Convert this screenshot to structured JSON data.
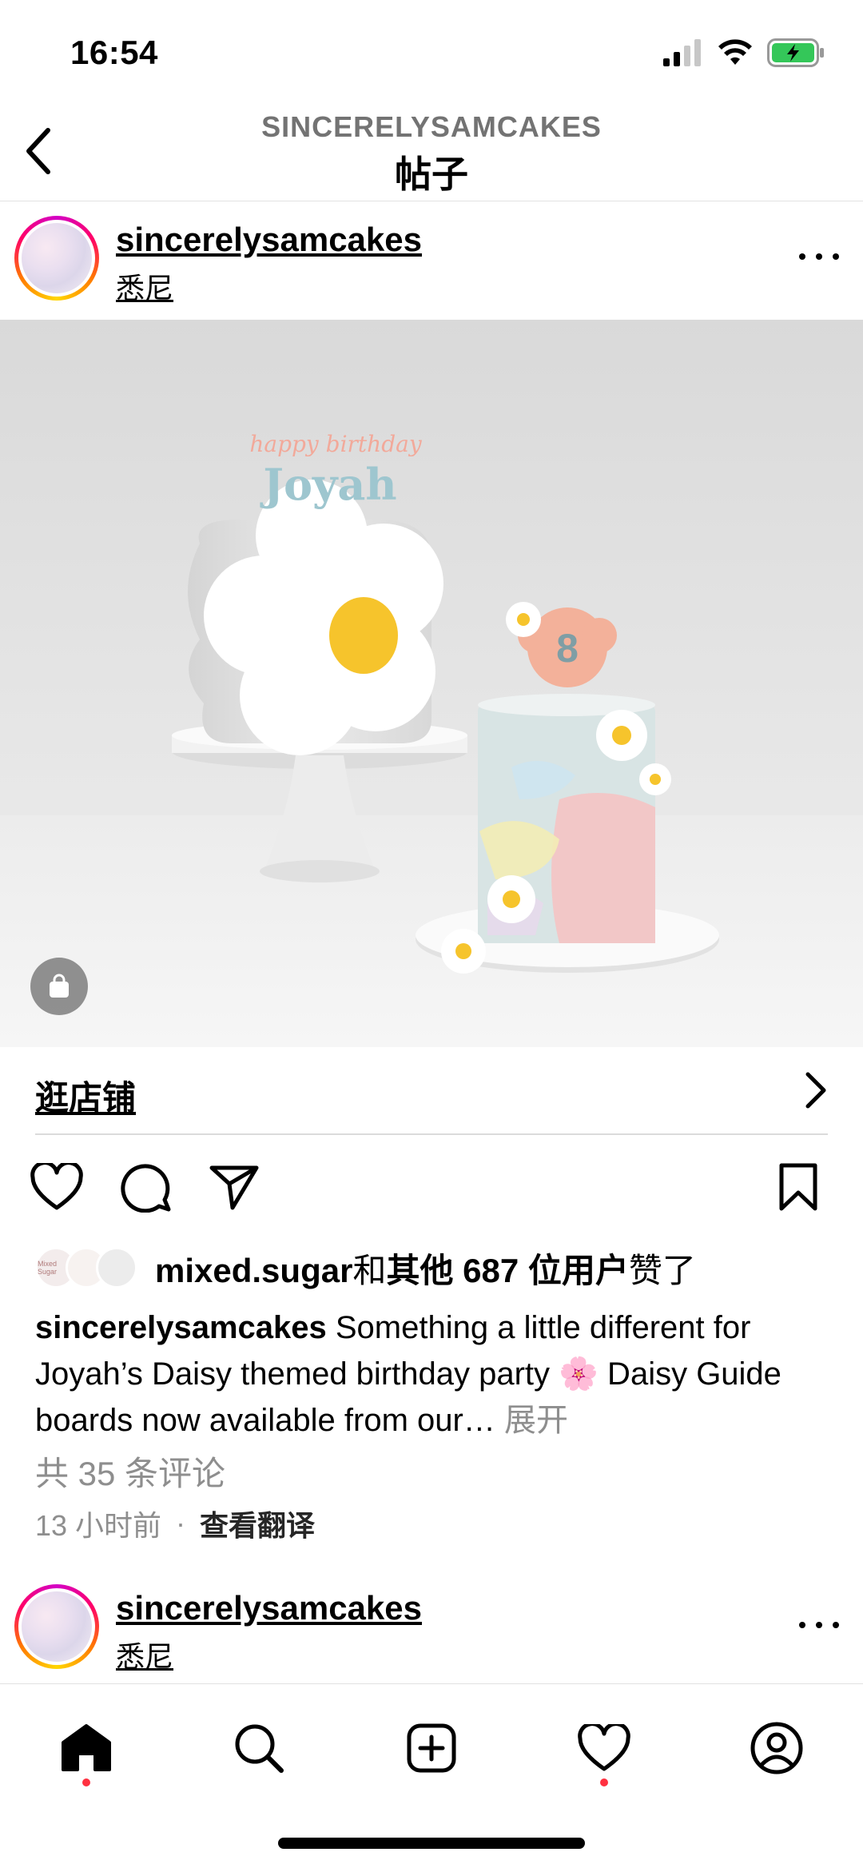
{
  "status_bar": {
    "time": "16:54"
  },
  "header": {
    "account": "SINCERELYSAMCAKES",
    "title": "帖子"
  },
  "post": {
    "username": "sincerelysamcakes",
    "location": "悉尼",
    "topper_text": "happy birthday Joyah",
    "topper_number": "8",
    "shop_label": "逛店铺",
    "liked_by_user": "mixed.sugar",
    "likes_connector": "和",
    "likes_others": "其他 687 位用户",
    "likes_suffix": "赞了",
    "liked_by_avatar_text": "Mixed Sugar",
    "caption_user": "sincerelysamcakes",
    "caption_text": "Something a little different for Joyah’s Daisy themed birthday party 🌸 Daisy Guide boards now available from our…",
    "caption_more": "展开",
    "comments": "共 35 条评论",
    "time_ago": "13 小时前",
    "time_separator": "·",
    "translate": "查看翻译"
  },
  "next_post": {
    "username": "sincerelysamcakes",
    "location": "悉尼"
  },
  "icons": {
    "back": "chevron-left-icon",
    "more": "more-horizontal-icon",
    "shop_badge": "shopping-bag-icon",
    "like": "heart-icon",
    "comment": "comment-icon",
    "share": "send-icon",
    "save": "bookmark-icon",
    "tabs": [
      "home-icon",
      "search-icon",
      "create-icon",
      "activity-heart-icon",
      "profile-icon"
    ]
  },
  "colors": {
    "notification_dot": "#ff3040",
    "battery": "#34c759",
    "secondary_text": "#8e8e8e"
  }
}
